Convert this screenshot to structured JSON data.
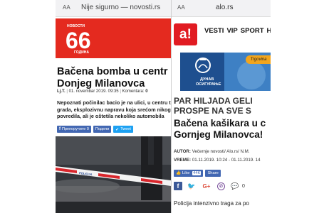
{
  "left": {
    "urlbar": {
      "aa": "AA",
      "security": "Nije sigurno — novosti.rs"
    },
    "logo": {
      "small_text": "НОВОСТИ",
      "number": "66",
      "sub_text": "ГОДИНА"
    },
    "article": {
      "title": "Bačena bomba u centr\nDonjeg Milanovca",
      "author": "Lj.T.",
      "date": "01. novembar 2019. 09:35",
      "comments_label": "Komentara:",
      "comments_count": "0",
      "lead": "Nepoznati počinilac bacio je na ulici, u centru t grada, eksplozivnu napravu koja srećom nikog povredila, ali je oštetila nekoliko automobila"
    },
    "share": {
      "recommend": "Препоручите 0",
      "share": "Подели",
      "tweet": "Tweet"
    },
    "photo": {
      "tape_text": "POLICIJA"
    }
  },
  "right": {
    "urlbar": {
      "aa": "AA",
      "domain": "alo.rs"
    },
    "logo": "a!",
    "nav": [
      "VESTI",
      "VIP",
      "SPORT",
      "HI"
    ],
    "ad": {
      "pill": "Trgovina",
      "brand_line1": "ДУНАВ",
      "brand_line2": "ОСИГУРАЊЕ"
    },
    "article": {
      "kicker": "PAR HILJADA GELI\nPROSPE NA SVE S",
      "title": "Bačena kašikara u c\nGornjeg Milanovca!",
      "author_label": "AUTOR:",
      "author_value": "Večernje novosti/ Alo.rs/ N.M.",
      "date_label": "VREME:",
      "date_value": "01.11.2019. 10:24 - 01.11.2019. 14",
      "body_start": "Policija intenzivno traga za po"
    },
    "like": {
      "like_label": "Like",
      "like_count": "44K",
      "share_label": "Share"
    },
    "social": {
      "comments_count": "0"
    }
  }
}
